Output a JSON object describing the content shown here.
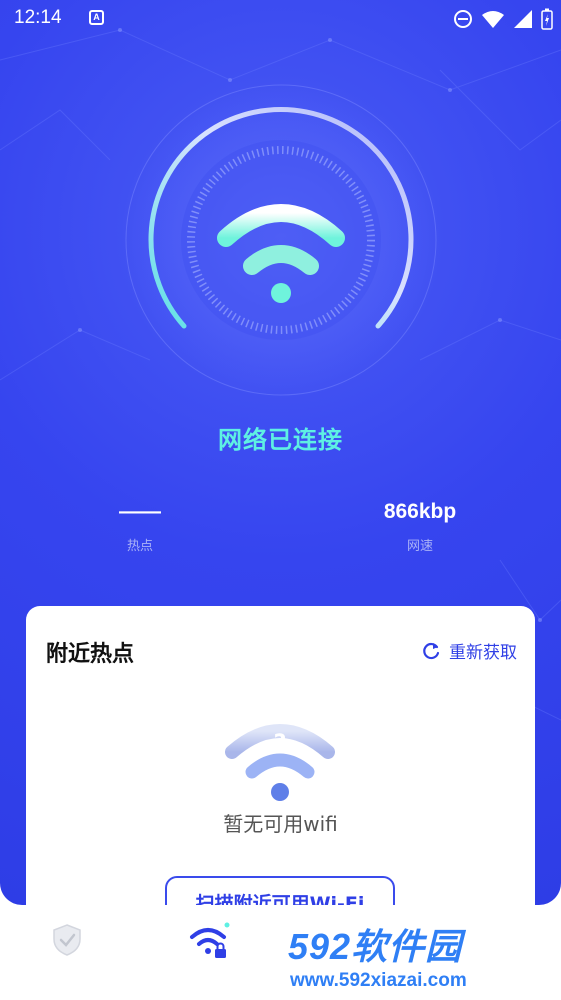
{
  "status_bar": {
    "time": "12:14",
    "icons": [
      "a-notification-icon",
      "do-not-disturb-icon",
      "wifi-icon",
      "signal-icon",
      "battery-icon"
    ]
  },
  "connection": {
    "status_text": "网络已连接",
    "hotspot_value": "——",
    "hotspot_label": "热点",
    "speed_value": "866kbp",
    "speed_label": "网速"
  },
  "nearby": {
    "title": "附近热点",
    "refresh_label": "重新获取",
    "empty_text": "暂无可用wifi",
    "scan_button_label": "扫描附近可用Wi-Fi"
  },
  "tabbar": {
    "tabs": [
      {
        "icon": "shield-check-icon",
        "active": false
      },
      {
        "icon": "wifi-lock-icon",
        "active": true
      }
    ]
  },
  "watermark": {
    "line1": "592软件园",
    "line2": "www.592xiazai.com"
  },
  "colors": {
    "primary_blue": "#3645ef",
    "accent_teal": "#5ef0e3",
    "card_bg": "#ffffff",
    "watermark_blue": "#2f7ff5"
  }
}
